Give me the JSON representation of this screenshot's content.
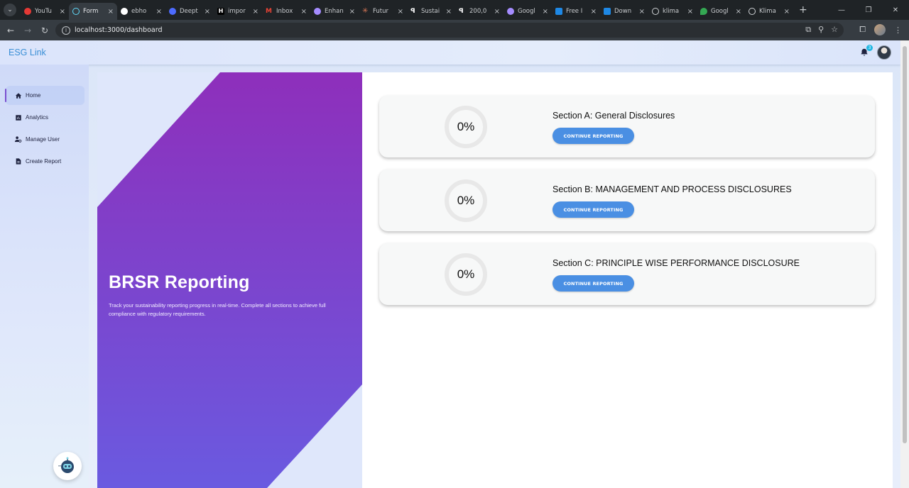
{
  "browser": {
    "tabs": [
      {
        "title": "YouTu",
        "favicon": "youtube-icon",
        "color": "#e53935",
        "active": false
      },
      {
        "title": "Form",
        "favicon": "react-icon",
        "color": "#61dafb",
        "active": true
      },
      {
        "title": "ebho",
        "favicon": "github-icon",
        "color": "#ffffff",
        "active": false
      },
      {
        "title": "Deept",
        "favicon": "deepseek-icon",
        "color": "#4d6bfe",
        "active": false
      },
      {
        "title": "impor",
        "favicon": "h-icon",
        "color": "#ffffff",
        "active": false
      },
      {
        "title": "Inbox",
        "favicon": "gmail-icon",
        "color": "#ea4335",
        "active": false
      },
      {
        "title": "Enhan",
        "favicon": "gear-icon",
        "color": "#a58cff",
        "active": false
      },
      {
        "title": "Futur",
        "favicon": "claude-icon",
        "color": "#d97757",
        "active": false
      },
      {
        "title": "Sustai",
        "favicon": "p-icon",
        "color": "#ffffff",
        "active": false
      },
      {
        "title": "200,0",
        "favicon": "p-icon",
        "color": "#ffffff",
        "active": false
      },
      {
        "title": "Googl",
        "favicon": "gear-icon",
        "color": "#a58cff",
        "active": false
      },
      {
        "title": "Free I",
        "favicon": "card-icon",
        "color": "#1e88e5",
        "active": false
      },
      {
        "title": "Down",
        "favicon": "card-icon",
        "color": "#1e88e5",
        "active": false
      },
      {
        "title": "klima",
        "favicon": "globe-icon",
        "color": "#cfd2d5",
        "active": false
      },
      {
        "title": "Googl",
        "favicon": "maps-icon",
        "color": "#34a853",
        "active": false
      },
      {
        "title": "Klima",
        "favicon": "globe-icon",
        "color": "#cfd2d5",
        "active": false
      }
    ],
    "url": "localhost:3000/dashboard"
  },
  "app": {
    "brand": "ESG Link",
    "notifications_count": "3",
    "nav": [
      {
        "label": "Home",
        "icon": "home-icon",
        "active": true
      },
      {
        "label": "Analytics",
        "icon": "chart-icon",
        "active": false
      },
      {
        "label": "Manage User",
        "icon": "user-gear-icon",
        "active": false
      },
      {
        "label": "Create Report",
        "icon": "report-icon",
        "active": false
      }
    ]
  },
  "hero": {
    "title": "BRSR Reporting",
    "description": "Track your sustainability reporting progress in real-time. Complete all sections to achieve full compliance with regulatory requirements."
  },
  "sections": [
    {
      "title": "Section A: General Disclosures",
      "progress": "0%",
      "button": "CONTINUE REPORTING"
    },
    {
      "title": "Section B: MANAGEMENT AND PROCESS DISCLOSURES",
      "progress": "0%",
      "button": "CONTINUE REPORTING"
    },
    {
      "title": "Section C: PRINCIPLE WISE PERFORMANCE DISCLOSURE",
      "progress": "0%",
      "button": "CONTINUE REPORTING"
    }
  ],
  "colors": {
    "brand": "#3a8fd6",
    "hero_top": "#8e2fbb",
    "hero_bottom": "#6a5ae0",
    "button": "#4a8fe3"
  }
}
